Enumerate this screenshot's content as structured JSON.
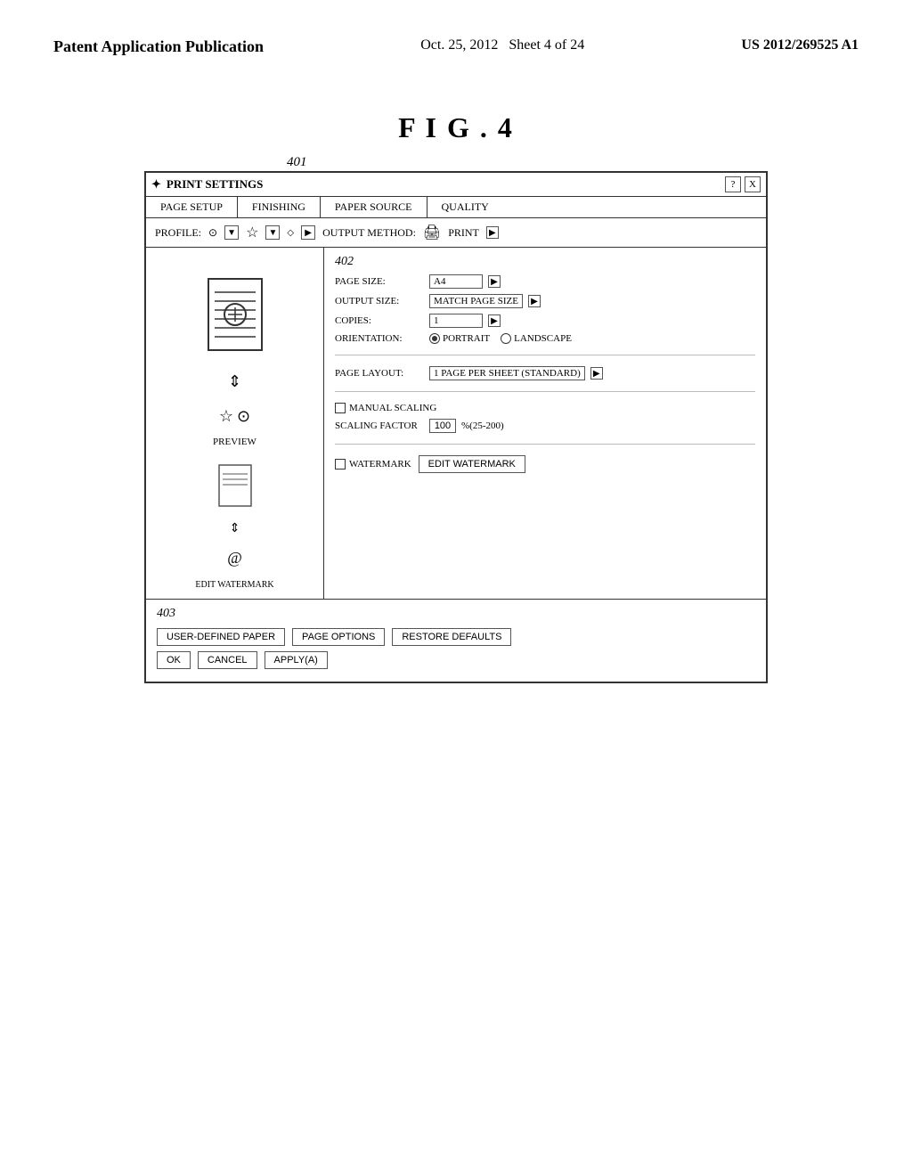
{
  "header": {
    "left": "Patent Application Publication",
    "center_date": "Oct. 25, 2012",
    "center_sheet": "Sheet 4 of 24",
    "right": "US 2012/269525 A1"
  },
  "figure": {
    "label": "F I G . 4",
    "dialog_id": "401",
    "panel_id": "402",
    "bottom_id": "403"
  },
  "dialog": {
    "title": "PRINT SETTINGS",
    "help_btn": "?",
    "close_btn": "X",
    "tabs": [
      "PAGE SETUP",
      "FINISHING",
      "PAPER SOURCE",
      "QUALITY"
    ],
    "profile_label": "PROFILE:",
    "profile_icon": "⊙",
    "profile_arrow": "▼",
    "quality_icon": "☆",
    "quality_arrow": "▼",
    "output_method_label": "OUTPUT METHOD:",
    "output_method_icon": "🖨",
    "output_method_value": "PRINT",
    "output_method_arrow": "▶",
    "settings": {
      "page_size_label": "PAGE SIZE:",
      "page_size_value": "A4",
      "page_size_arrow": "▶",
      "output_size_label": "OUTPUT SIZE:",
      "output_size_value": "MATCH PAGE SIZE",
      "output_size_arrow": "▶",
      "copies_label": "COPIES:",
      "copies_value": "1",
      "copies_arrow": "▶",
      "orientation_label": "ORIENTATION:",
      "orientation_portrait": "PORTRAIT",
      "orientation_landscape": "LANDSCAPE",
      "page_layout_label": "PAGE LAYOUT:",
      "page_layout_value": "1 PAGE PER SHEET (STANDARD)",
      "page_layout_arrow": "▶",
      "manual_scaling_label": "MANUAL SCALING",
      "scaling_factor_label": "SCALING FACTOR",
      "scaling_value": "100",
      "scaling_range": "%(25-200)",
      "watermark_label": "WATERMARK",
      "edit_watermark_btn": "EDIT WATERMARK",
      "preview_label": "PREVIEW",
      "edit_watermark_label": "EDIT WATERMARK"
    },
    "bottom": {
      "user_defined_btn": "USER-DEFINED PAPER",
      "page_options_btn": "PAGE OPTIONS",
      "restore_defaults_btn": "RESTORE DEFAULTS",
      "ok_btn": "OK",
      "cancel_btn": "CANCEL",
      "apply_btn": "APPLY(A)"
    }
  }
}
